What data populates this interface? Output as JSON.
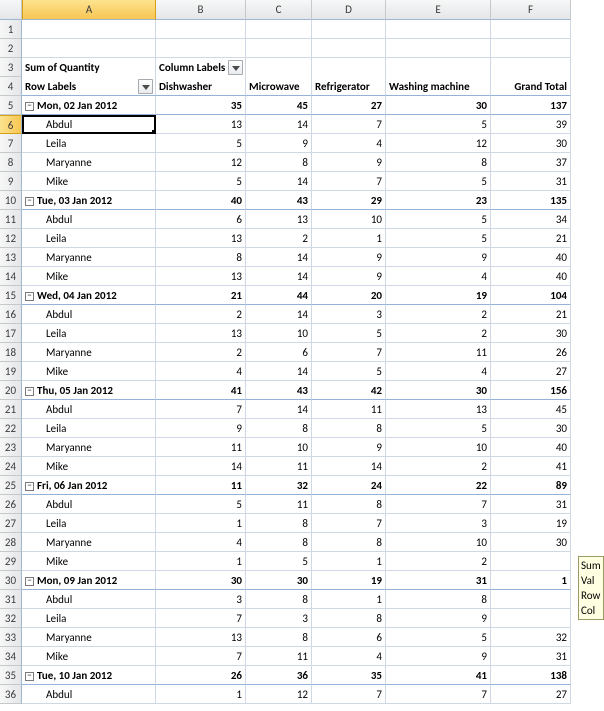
{
  "columns": [
    "A",
    "B",
    "C",
    "D",
    "E",
    "F"
  ],
  "active_col": 0,
  "active_row": 6,
  "pivot": {
    "sum_label": "Sum of Quantity",
    "col_labels_label": "Column Labels",
    "row_labels_label": "Row Labels",
    "col_fields": [
      "Dishwasher",
      "Microwave",
      "Refrigerator",
      "Washing machine",
      "Grand Total"
    ]
  },
  "rows": [
    {
      "n": 1,
      "empty": true
    },
    {
      "n": 2,
      "empty": true
    },
    {
      "n": 3,
      "type": "pivot_top"
    },
    {
      "n": 4,
      "type": "pivot_cols"
    },
    {
      "n": 5,
      "type": "group",
      "label": "Mon, 02 Jan 2012",
      "vals": [
        35,
        45,
        27,
        30,
        137
      ]
    },
    {
      "n": 6,
      "type": "item",
      "label": "Abdul",
      "vals": [
        13,
        14,
        7,
        5,
        39
      ],
      "selected": true
    },
    {
      "n": 7,
      "type": "item",
      "label": "Leila",
      "vals": [
        5,
        9,
        4,
        12,
        30
      ]
    },
    {
      "n": 8,
      "type": "item",
      "label": "Maryanne",
      "vals": [
        12,
        8,
        9,
        8,
        37
      ]
    },
    {
      "n": 9,
      "type": "item",
      "label": "Mike",
      "vals": [
        5,
        14,
        7,
        5,
        31
      ]
    },
    {
      "n": 10,
      "type": "group",
      "label": "Tue, 03 Jan 2012",
      "vals": [
        40,
        43,
        29,
        23,
        135
      ]
    },
    {
      "n": 11,
      "type": "item",
      "label": "Abdul",
      "vals": [
        6,
        13,
        10,
        5,
        34
      ]
    },
    {
      "n": 12,
      "type": "item",
      "label": "Leila",
      "vals": [
        13,
        2,
        1,
        5,
        21
      ]
    },
    {
      "n": 13,
      "type": "item",
      "label": "Maryanne",
      "vals": [
        8,
        14,
        9,
        9,
        40
      ]
    },
    {
      "n": 14,
      "type": "item",
      "label": "Mike",
      "vals": [
        13,
        14,
        9,
        4,
        40
      ]
    },
    {
      "n": 15,
      "type": "group",
      "label": "Wed, 04 Jan 2012",
      "vals": [
        21,
        44,
        20,
        19,
        104
      ]
    },
    {
      "n": 16,
      "type": "item",
      "label": "Abdul",
      "vals": [
        2,
        14,
        3,
        2,
        21
      ]
    },
    {
      "n": 17,
      "type": "item",
      "label": "Leila",
      "vals": [
        13,
        10,
        5,
        2,
        30
      ]
    },
    {
      "n": 18,
      "type": "item",
      "label": "Maryanne",
      "vals": [
        2,
        6,
        7,
        11,
        26
      ]
    },
    {
      "n": 19,
      "type": "item",
      "label": "Mike",
      "vals": [
        4,
        14,
        5,
        4,
        27
      ]
    },
    {
      "n": 20,
      "type": "group",
      "label": "Thu, 05 Jan 2012",
      "vals": [
        41,
        43,
        42,
        30,
        156
      ]
    },
    {
      "n": 21,
      "type": "item",
      "label": "Abdul",
      "vals": [
        7,
        14,
        11,
        13,
        45
      ]
    },
    {
      "n": 22,
      "type": "item",
      "label": "Leila",
      "vals": [
        9,
        8,
        8,
        5,
        30
      ]
    },
    {
      "n": 23,
      "type": "item",
      "label": "Maryanne",
      "vals": [
        11,
        10,
        9,
        10,
        40
      ]
    },
    {
      "n": 24,
      "type": "item",
      "label": "Mike",
      "vals": [
        14,
        11,
        14,
        2,
        41
      ]
    },
    {
      "n": 25,
      "type": "group",
      "label": "Fri, 06 Jan 2012",
      "vals": [
        11,
        32,
        24,
        22,
        89
      ]
    },
    {
      "n": 26,
      "type": "item",
      "label": "Abdul",
      "vals": [
        5,
        11,
        8,
        7,
        31
      ]
    },
    {
      "n": 27,
      "type": "item",
      "label": "Leila",
      "vals": [
        1,
        8,
        7,
        3,
        19
      ]
    },
    {
      "n": 28,
      "type": "item",
      "label": "Maryanne",
      "vals": [
        4,
        8,
        8,
        10,
        30
      ]
    },
    {
      "n": 29,
      "type": "item",
      "label": "Mike",
      "vals": [
        1,
        5,
        1,
        2,
        ""
      ]
    },
    {
      "n": 30,
      "type": "group",
      "label": "Mon, 09 Jan 2012",
      "vals": [
        30,
        30,
        19,
        31,
        "1"
      ]
    },
    {
      "n": 31,
      "type": "item",
      "label": "Abdul",
      "vals": [
        3,
        8,
        1,
        8,
        ""
      ]
    },
    {
      "n": 32,
      "type": "item",
      "label": "Leila",
      "vals": [
        7,
        3,
        8,
        9,
        ""
      ]
    },
    {
      "n": 33,
      "type": "item",
      "label": "Maryanne",
      "vals": [
        13,
        8,
        6,
        5,
        32
      ]
    },
    {
      "n": 34,
      "type": "item",
      "label": "Mike",
      "vals": [
        7,
        11,
        4,
        9,
        31
      ]
    },
    {
      "n": 35,
      "type": "group",
      "label": "Tue, 10 Jan 2012",
      "vals": [
        26,
        36,
        35,
        41,
        138
      ]
    },
    {
      "n": 36,
      "type": "item",
      "label": "Abdul",
      "vals": [
        1,
        12,
        7,
        7,
        27
      ]
    }
  ],
  "tooltip": {
    "line1": "Sum",
    "line2": "Val",
    "line3": "Row",
    "line4": "Col"
  }
}
